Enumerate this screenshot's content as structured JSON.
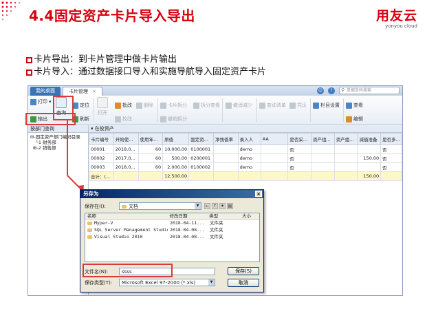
{
  "slide": {
    "title": "4.4固定资产卡片导入导出",
    "logo_main": "用友云",
    "logo_sub": "yonyou cloud",
    "bullets": [
      "卡片导出：到卡片管理中做卡片输出",
      "卡片导入：通过数据接口导入和实施导航导入固定资产卡片"
    ],
    "accent_color": "#d7000f"
  },
  "app": {
    "tabs": [
      "我的桌面",
      "卡片管理"
    ],
    "search_placeholder": "单据条码搜索",
    "toolbar": {
      "print": "打印",
      "locate": "定位",
      "export": "输出",
      "query": "查询",
      "refresh": "刷新",
      "open": "打开",
      "change": "批改",
      "delete": "删除",
      "verify": "校改",
      "split": "卡片拆分",
      "split_view": "拆分查看",
      "undo_reduce": "撤消减少",
      "undo_split": "撤销拆分",
      "change_list": "变动清单",
      "voucher": "凭证",
      "column_settings": "栏目设置",
      "view": "查看",
      "edit": "编辑"
    },
    "left_pane": {
      "header": "按部门查询",
      "tree": [
        "固定资产部门编码目录",
        "1 财务部",
        "2 销售部"
      ]
    },
    "grid": {
      "title": "在役资产",
      "columns": [
        "卡片编号",
        "开始使...",
        "使用年...",
        "原值",
        "固定资...",
        "净残值率",
        "录入人",
        "AA",
        "是否采...",
        "资产组...",
        "资产组...",
        "减值准备",
        "是否多..."
      ],
      "rows": [
        [
          "00001",
          "2018.0...",
          "60",
          "10,000.00",
          "0100001",
          "",
          "demo",
          "",
          "否",
          "",
          "",
          "",
          "否"
        ],
        [
          "00002",
          "2017.0...",
          "60",
          "500.00",
          "0200001",
          "",
          "demo",
          "",
          "否",
          "",
          "",
          "150.00",
          "否"
        ],
        [
          "00003",
          "2018.0...",
          "60",
          "2,000.00",
          "0100002",
          "",
          "demo",
          "",
          "否",
          "",
          "",
          "",
          "否"
        ]
      ],
      "total_row": [
        "合计：(...",
        "",
        "",
        "12,500.00",
        "",
        "",
        "",
        "",
        "",
        "",
        "",
        "150.00",
        ""
      ]
    }
  },
  "save_dialog": {
    "title": "另存为",
    "save_in_label": "保存在(I):",
    "save_in_value": "文档",
    "list_headers": [
      "名称",
      "修改日期",
      "类型",
      "大小"
    ],
    "files": [
      {
        "name": "Myper-V",
        "date": "2018-04-11...",
        "type": "文件夹"
      },
      {
        "name": "SQL Server Management Studio",
        "date": "2018-04-08...",
        "type": "文件夹"
      },
      {
        "name": "Visual Studio 2010",
        "date": "2018-04-08...",
        "type": "文件夹"
      }
    ],
    "filename_label": "文件名(N):",
    "filename_value": "ssss",
    "filetype_label": "保存类型(T):",
    "filetype_value": "Microsoft Excel 97-2000 (*.xls)",
    "save_button": "保存(S)",
    "cancel_button": "取消"
  }
}
